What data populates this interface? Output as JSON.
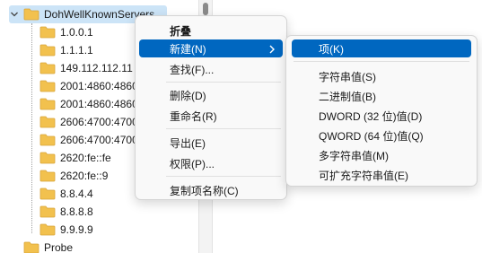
{
  "tree": {
    "parent_key": "DohWellKnownServers",
    "children": [
      "1.0.0.1",
      "1.1.1.1",
      "149.112.112.11",
      "2001:4860:4860",
      "2001:4860:4860",
      "2606:4700:4700",
      "2606:4700:4700",
      "2620:fe::fe",
      "2620:fe::9",
      "8.8.4.4",
      "8.8.8.8",
      "9.9.9.9"
    ],
    "sibling_key": "Probe"
  },
  "context_menu": {
    "collapse": "折叠",
    "new": "新建(N)",
    "find": "查找(F)...",
    "delete": "删除(D)",
    "rename": "重命名(R)",
    "export": "导出(E)",
    "permissions": "权限(P)...",
    "copy_key_name": "复制项名称(C)"
  },
  "new_submenu": {
    "key": "项(K)",
    "string_value": "字符串值(S)",
    "binary_value": "二进制值(B)",
    "dword_value": "DWORD (32 位)值(D)",
    "qword_value": "QWORD (64 位)值(Q)",
    "multi_string_value": "多字符串值(M)",
    "expandable_string_value": "可扩充字符串值(E)"
  },
  "colors": {
    "folder": "#f2c14e",
    "selection": "#cce4f7",
    "menu_highlight": "#0067c0"
  }
}
